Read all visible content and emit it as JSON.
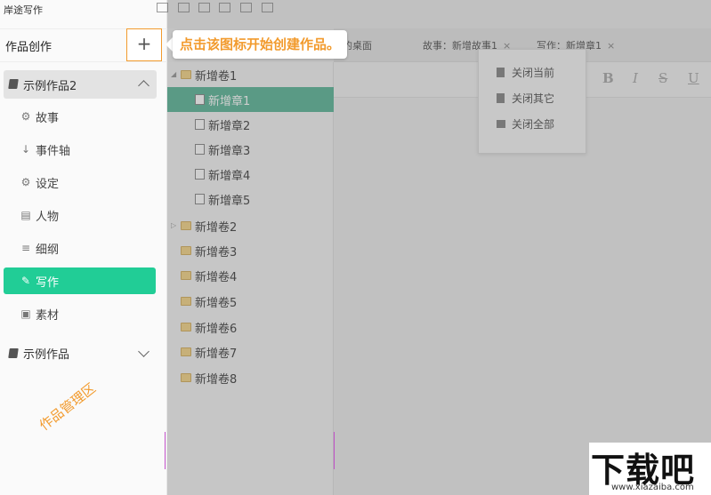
{
  "app": {
    "title": "岸途写作"
  },
  "sidebar": {
    "works_title": "作品创作",
    "add_button": "+",
    "project_1": {
      "label": "示例作品2"
    },
    "items": [
      {
        "icon": "⚙",
        "label": "故事"
      },
      {
        "icon": "↓",
        "label": "事件轴"
      },
      {
        "icon": "⚙",
        "label": "设定"
      },
      {
        "icon": "▤",
        "label": "人物"
      },
      {
        "icon": "≡",
        "label": "细纲"
      },
      {
        "icon": "✎",
        "label": "写作"
      },
      {
        "icon": "▣",
        "label": "素材"
      }
    ],
    "active_item": "写作",
    "project_2": {
      "label": "示例作品"
    },
    "manage_label": "作品管理区"
  },
  "callout": {
    "text": "点击该图标开始创建作品。"
  },
  "tabs": [
    {
      "label": "的桌面"
    },
    {
      "label": "故事：新增故事1",
      "close": "×"
    },
    {
      "label": "写作：新增章1",
      "close": "×"
    }
  ],
  "tree": {
    "rows": [
      {
        "label": "新增卷1",
        "type": "folder"
      },
      {
        "label": "新增章1",
        "type": "doc",
        "selected": true
      },
      {
        "label": "新增章2",
        "type": "doc"
      },
      {
        "label": "新增章3",
        "type": "doc"
      },
      {
        "label": "新增章4",
        "type": "doc"
      },
      {
        "label": "新增章5",
        "type": "doc"
      },
      {
        "label": "新增卷2",
        "type": "folder"
      },
      {
        "label": "新增卷3",
        "type": "folder"
      },
      {
        "label": "新增卷4",
        "type": "folder"
      },
      {
        "label": "新增卷5",
        "type": "folder"
      },
      {
        "label": "新增卷6",
        "type": "folder"
      },
      {
        "label": "新增卷7",
        "type": "folder"
      },
      {
        "label": "新增卷8",
        "type": "folder"
      }
    ]
  },
  "context_menu": {
    "items": [
      {
        "label": "关闭当前"
      },
      {
        "label": "关闭其它"
      },
      {
        "label": "关闭全部"
      }
    ]
  },
  "format_bar": {
    "bold": "B",
    "italic": "I",
    "strike": "S",
    "underline": "U"
  },
  "watermark": {
    "text": "下载吧",
    "url": "www.xiazaiba.com"
  },
  "colors": {
    "accent": "#21cd96",
    "callout": "#f29b2e",
    "selected_row": "#5fb89a"
  }
}
